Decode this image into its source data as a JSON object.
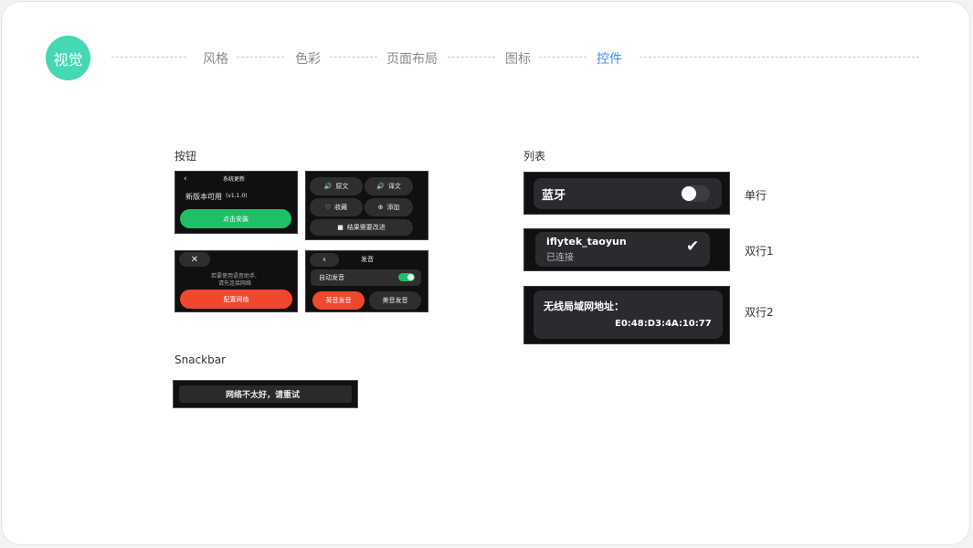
{
  "header": {
    "badge": "视觉",
    "nav": [
      "风格",
      "色彩",
      "页面布局",
      "图标",
      "控件"
    ],
    "active_index": 4,
    "accent_color": "#3d8ef0",
    "badge_color": "#44d8b4"
  },
  "buttons_section": {
    "title": "按钮",
    "update_screen": {
      "back": "‹",
      "title": "系统更新",
      "message": "新版本可用",
      "version": "(v1.1.0)",
      "install_button": "点击安装"
    },
    "action_screen": {
      "original": "原文",
      "translation": "译文",
      "favorite": "收藏",
      "add": "添加",
      "feedback": "结果需要改进"
    },
    "network_screen": {
      "close": "✕",
      "line1": "若要使用语音助手,",
      "line2": "请先连接网络",
      "config_button": "配置网络"
    },
    "voice_screen": {
      "back": "‹",
      "title": "发音",
      "auto_label": "自动发音",
      "auto_on": true,
      "british": "英音发音",
      "american": "美音发音"
    }
  },
  "snackbar_section": {
    "title": "Snackbar",
    "message": "网络不太好，请重试"
  },
  "list_section": {
    "title": "列表",
    "single": {
      "label": "蓝牙",
      "toggle_on": false,
      "caption": "单行"
    },
    "double1": {
      "title": "iflytek_taoyun",
      "subtitle": "已连接",
      "caption": "双行1"
    },
    "double2": {
      "title": "无线局域网地址：",
      "value": "E0:48:D3:4A:10:77",
      "caption": "双行2"
    }
  }
}
